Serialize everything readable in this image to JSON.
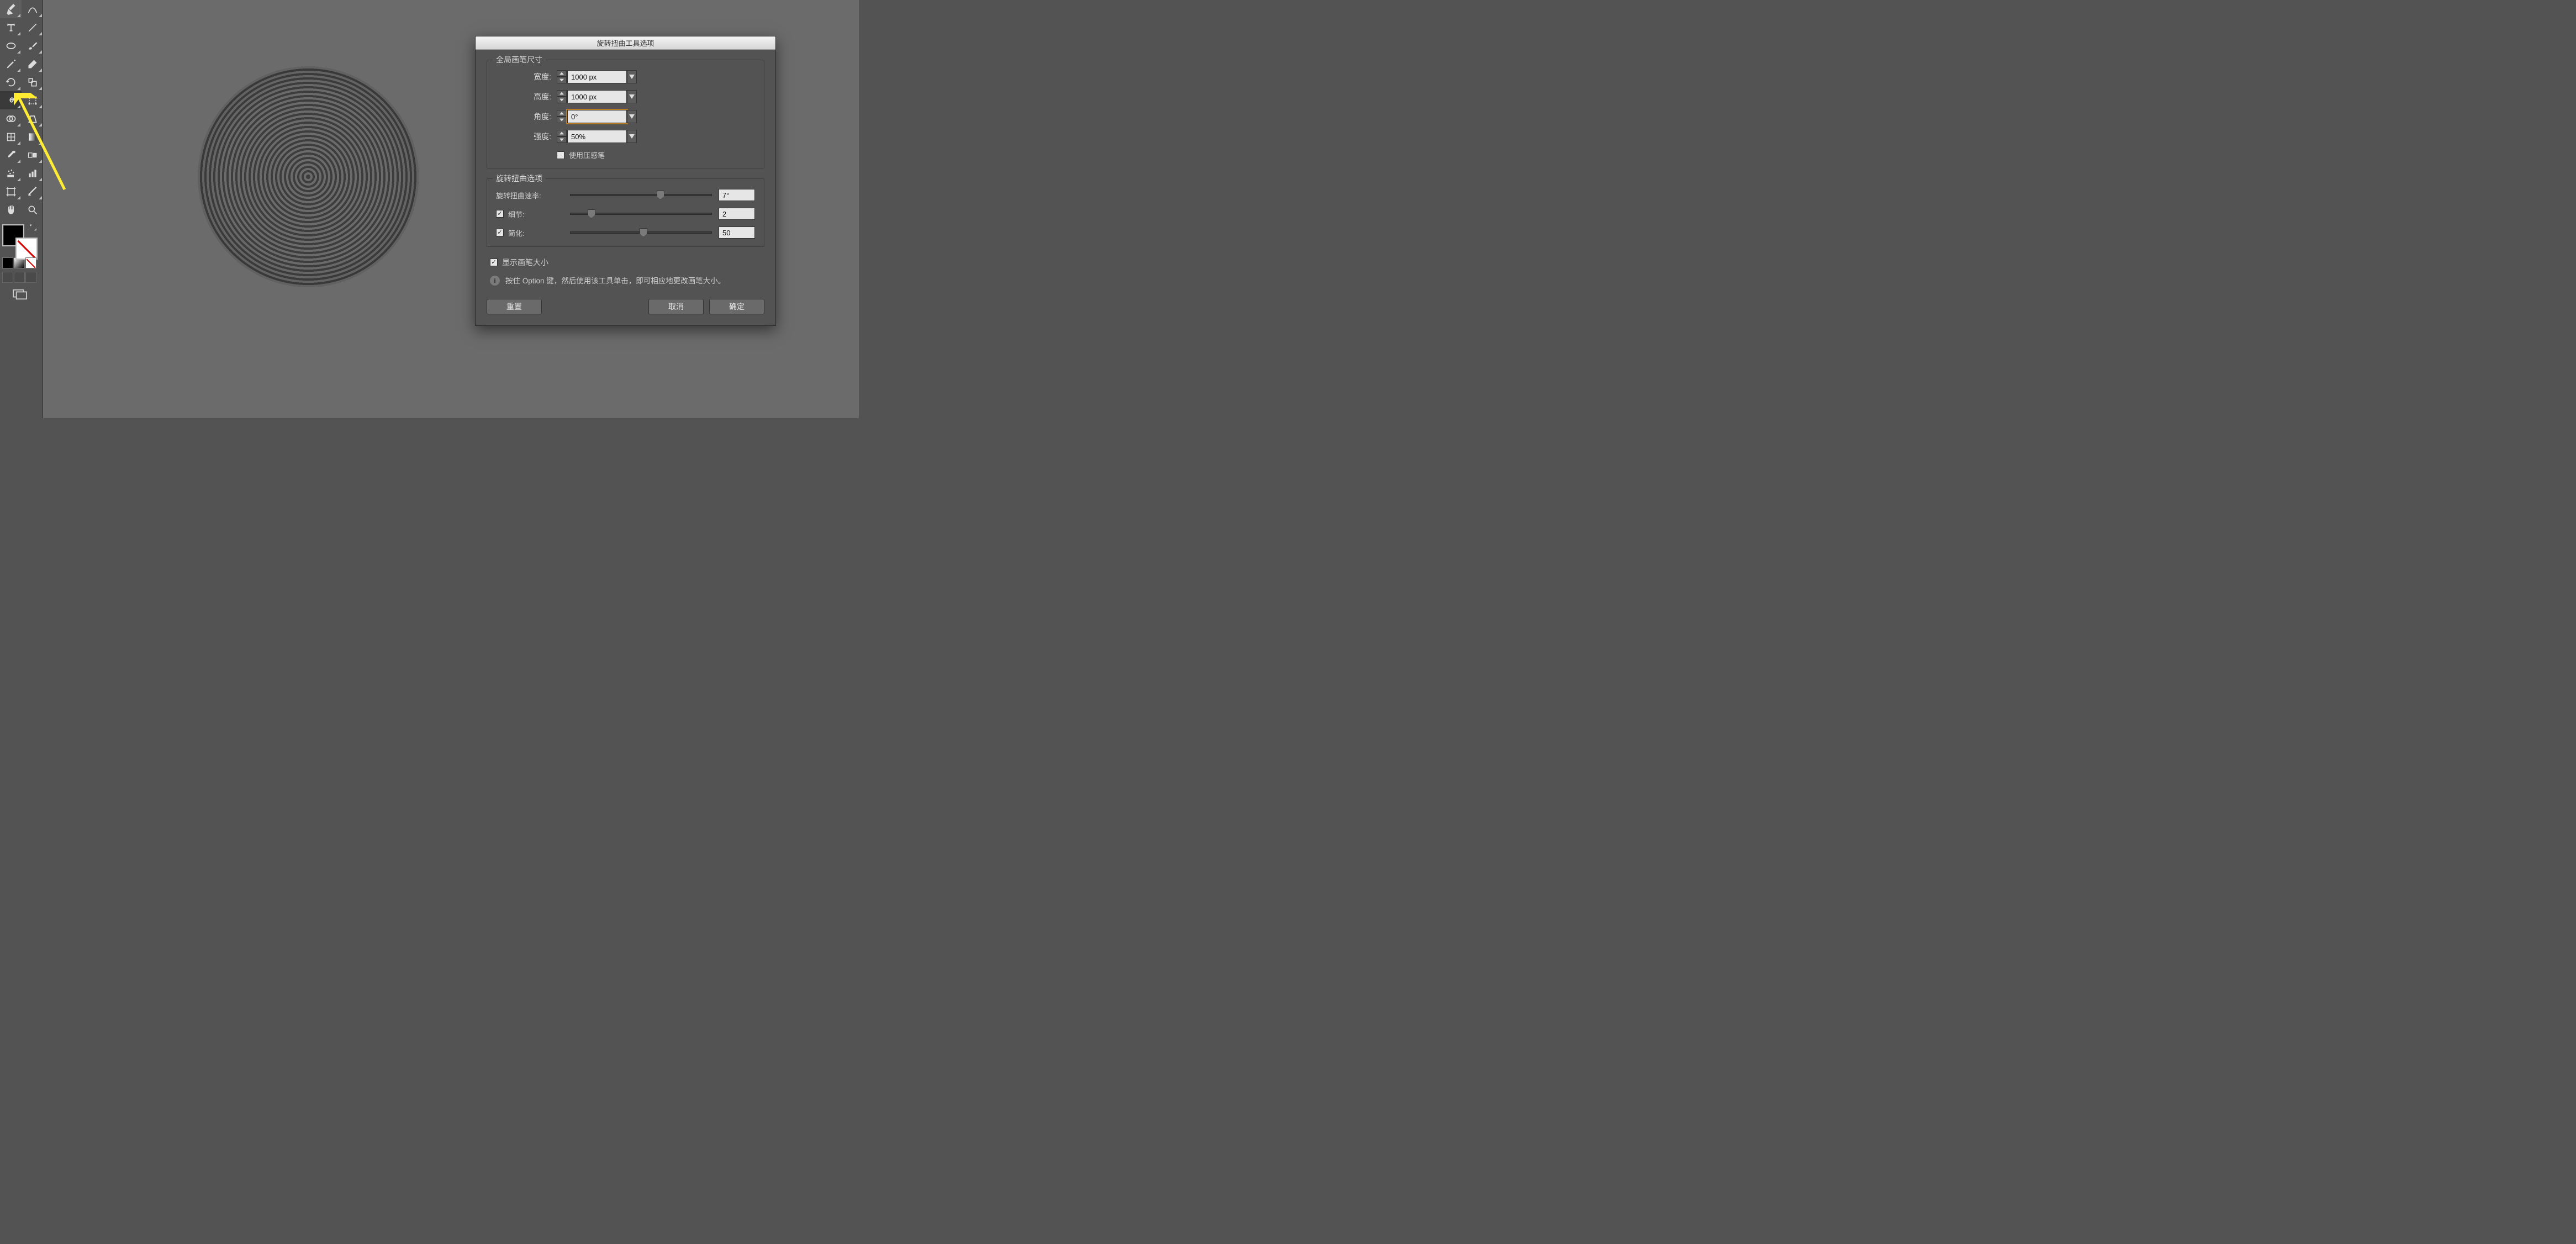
{
  "dialog": {
    "title": "旋转扭曲工具选项",
    "group1_legend": "全局画笔尺寸",
    "width_label": "宽度:",
    "width_value": "1000 px",
    "height_label": "高度:",
    "height_value": "1000 px",
    "angle_label": "角度:",
    "angle_value": "0°",
    "intensity_label": "强度:",
    "intensity_value": "50%",
    "pressure_label": "使用压感笔",
    "group2_legend": "旋转扭曲选项",
    "rate_label": "旋转扭曲速率:",
    "rate_value": "7°",
    "detail_label": "细节:",
    "detail_value": "2",
    "simplify_label": "简化:",
    "simplify_value": "50",
    "show_brush_label": "显示画笔大小",
    "hint_text": "按住 Option 键，然后使用该工具单击，即可相应地更改画笔大小。",
    "reset_label": "重置",
    "cancel_label": "取消",
    "ok_label": "确定"
  },
  "sliders": {
    "rate_pct": 61,
    "detail_pct": 12,
    "simplify_pct": 49
  },
  "tools": [
    "pen-tool",
    "add-anchor-tool",
    "type-tool",
    "line-tool",
    "ellipse-tool",
    "paintbrush-tool",
    "pencil-tool",
    "eraser-tool",
    "rotate-tool",
    "reflect-tool",
    "twirl-tool",
    "free-transform-tool",
    "width-tool",
    "warp-tool",
    "shape-builder-tool",
    "graph-tool",
    "eyedropper-tool",
    "gradient-tool",
    "symbol-sprayer-tool",
    "column-graph-tool",
    "artboard-tool",
    "slice-tool",
    "hand-tool",
    "zoom-tool"
  ]
}
